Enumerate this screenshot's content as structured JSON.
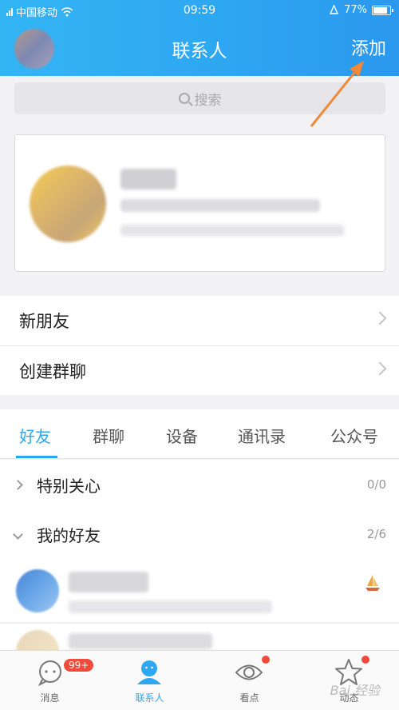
{
  "status_bar": {
    "carrier": "中国移动",
    "time": "09:59",
    "battery": "77%"
  },
  "nav": {
    "title": "联系人",
    "add_label": "添加"
  },
  "search": {
    "placeholder": "搜索"
  },
  "list": {
    "new_friends": "新朋友",
    "create_group": "创建群聊"
  },
  "tabs": [
    {
      "label": "好友",
      "active": true
    },
    {
      "label": "群聊",
      "active": false
    },
    {
      "label": "设备",
      "active": false
    },
    {
      "label": "通讯录",
      "active": false
    },
    {
      "label": "公众号",
      "active": false
    }
  ],
  "groups": [
    {
      "name": "特别关心",
      "count": "0/0",
      "expanded": false
    },
    {
      "name": "我的好友",
      "count": "2/6",
      "expanded": true
    }
  ],
  "bottom_nav": [
    {
      "label": "消息",
      "icon": "message-icon",
      "badge": "99+",
      "active": false
    },
    {
      "label": "联系人",
      "icon": "contacts-icon",
      "active": true
    },
    {
      "label": "看点",
      "icon": "eye-icon",
      "active": false
    },
    {
      "label": "动态",
      "icon": "star-icon",
      "active": false
    }
  ],
  "colors": {
    "accent": "#2ea7f1",
    "badge": "#f04b3b",
    "annotation_arrow": "#f08a3a"
  },
  "watermark": "Bai 经验"
}
